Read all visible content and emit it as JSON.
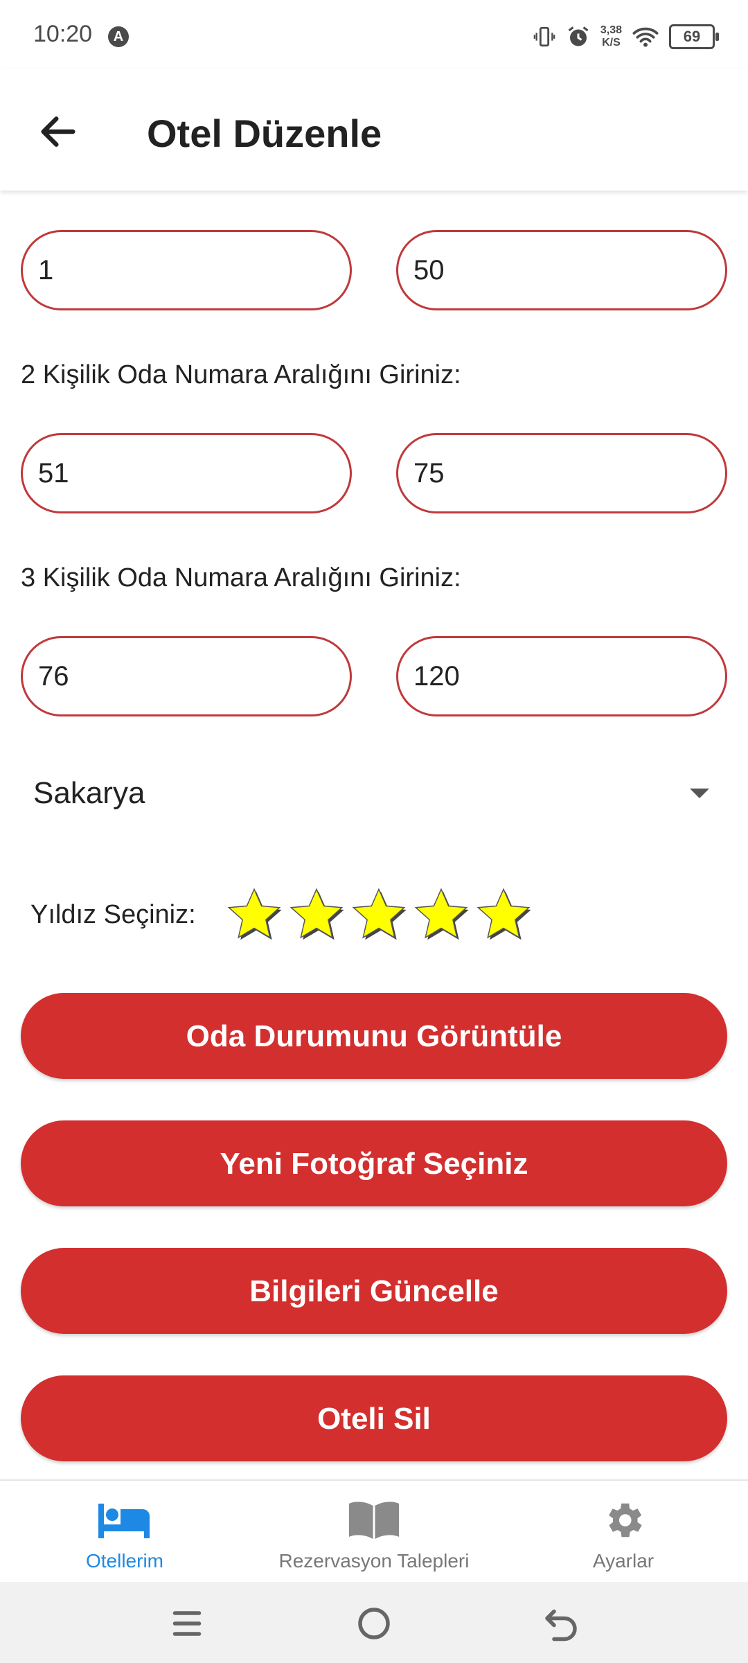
{
  "status": {
    "time": "10:20",
    "notification_letter": "A",
    "net_speed_value": "3,38",
    "net_speed_unit": "K/S",
    "battery": "69"
  },
  "header": {
    "title": "Otel Düzenle",
    "back_icon": "arrow-left-icon"
  },
  "form": {
    "single_room_start": "1",
    "single_room_end": "50",
    "double_label": "2 Kişilik Oda Numara Aralığını Giriniz:",
    "double_room_start": "51",
    "double_room_end": "75",
    "triple_label": "3 Kişilik Oda Numara Aralığını Giriniz:",
    "triple_room_start": "76",
    "triple_room_end": "120",
    "city": "Sakarya",
    "stars_label": "Yıldız Seçiniz:",
    "star_rating": 5,
    "star_max": 5
  },
  "buttons": {
    "room_status": "Oda Durumunu Görüntüle",
    "new_photo": "Yeni Fotoğraf Seçiniz",
    "update_info": "Bilgileri Güncelle",
    "delete_hotel": "Oteli Sil"
  },
  "bottom_nav": {
    "items": [
      {
        "label": "Otellerim",
        "icon": "bed-icon",
        "active": true
      },
      {
        "label": "Rezervasyon Talepleri",
        "icon": "book-icon",
        "active": false
      },
      {
        "label": "Ayarlar",
        "icon": "gear-icon",
        "active": false
      }
    ]
  },
  "colors": {
    "accent_red": "#d32f2f",
    "field_border": "#c0393b",
    "active_nav": "#1e88e5",
    "star_fill": "#ffff00"
  }
}
